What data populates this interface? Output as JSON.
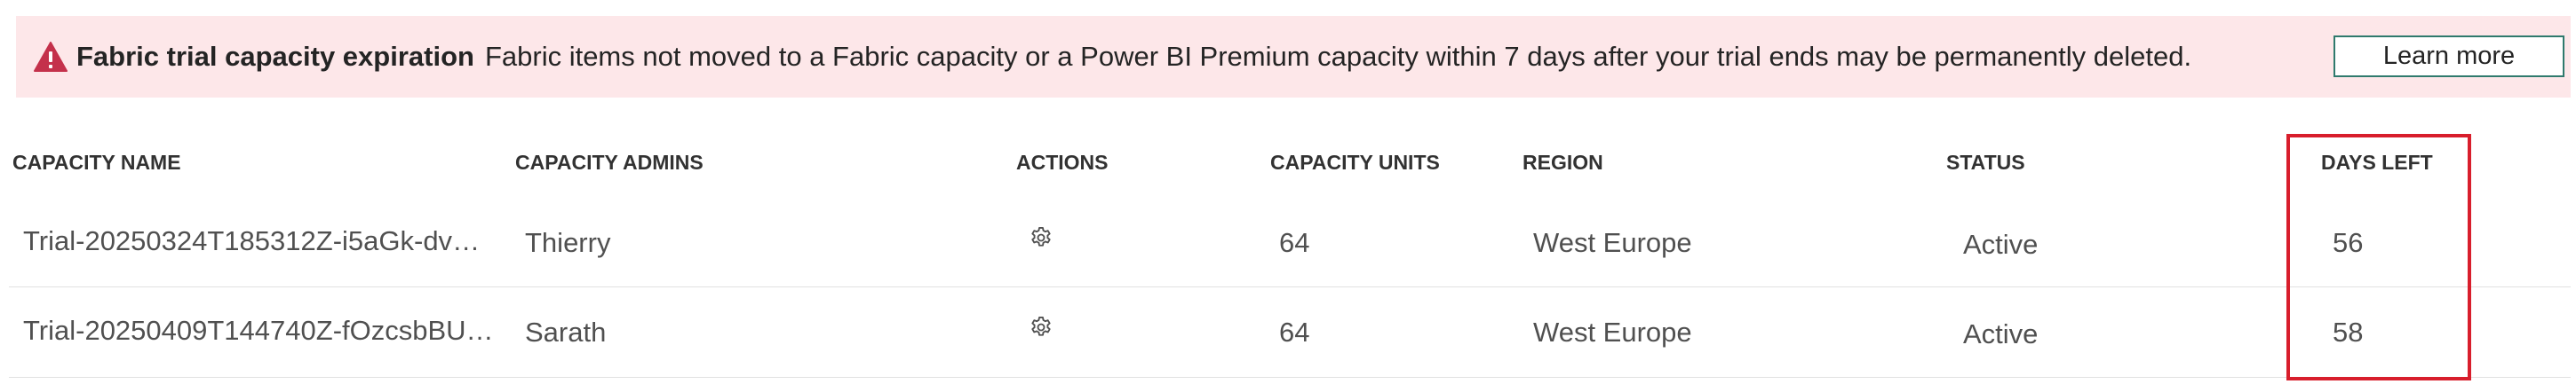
{
  "banner": {
    "title": "Fabric trial capacity expiration",
    "message": "Fabric items not moved to a Fabric capacity or a Power BI Premium capacity within 7 days after your trial ends may be permanently deleted.",
    "learn_more_label": "Learn more",
    "icon": "warning-icon",
    "background_color": "#fde7e9",
    "icon_color": "#c4314b"
  },
  "table": {
    "headers": {
      "capacity_name": "CAPACITY NAME",
      "capacity_admins": "CAPACITY ADMINS",
      "actions": "ACTIONS",
      "capacity_units": "CAPACITY UNITS",
      "region": "REGION",
      "status": "STATUS",
      "days_left": "DAYS LEFT"
    },
    "rows": [
      {
        "capacity_name": "Trial-20250324T185312Z-i5aGk-dvC...",
        "capacity_admins": "Thierry",
        "actions_icon": "gear-icon",
        "capacity_units": "64",
        "region": "West Europe",
        "status": "Active",
        "days_left": "56"
      },
      {
        "capacity_name": "Trial-20250409T144740Z-fOzcsbBU0...",
        "capacity_admins": "Sarath",
        "actions_icon": "gear-icon",
        "capacity_units": "64",
        "region": "West Europe",
        "status": "Active",
        "days_left": "58"
      }
    ],
    "highlight_color": "#d81e2c"
  }
}
